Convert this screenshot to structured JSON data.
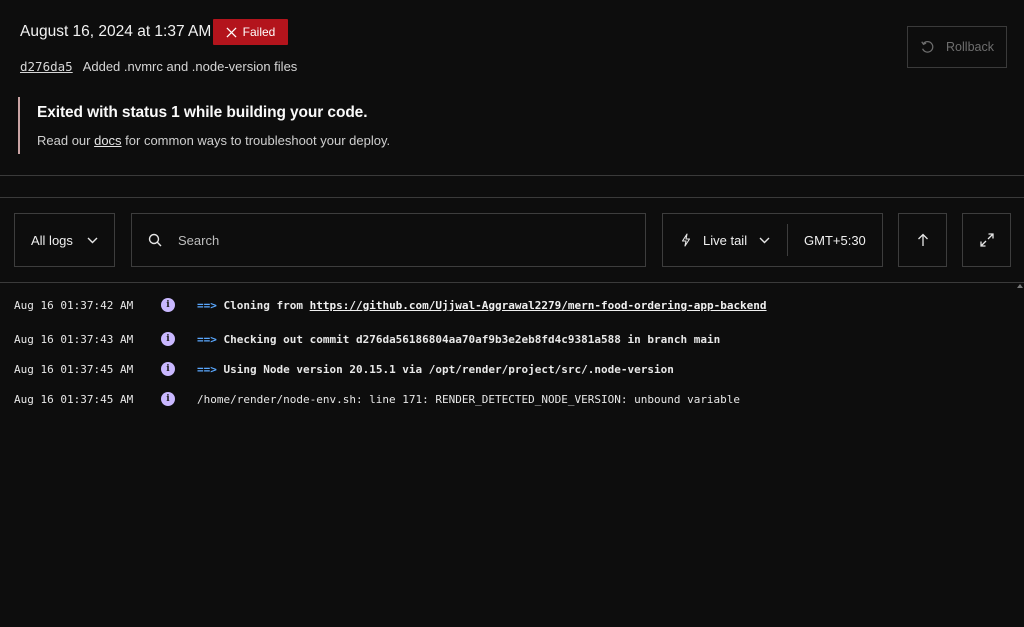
{
  "deploy": {
    "date": "August 16, 2024 at 1:37 AM",
    "status": "Failed",
    "commit_hash": "d276da5",
    "commit_message": "Added .nvmrc and .node-version files",
    "rollback_label": "Rollback"
  },
  "error": {
    "title": "Exited with status 1 while building your code.",
    "prefix": "Read our ",
    "link": "docs",
    "suffix": " for common ways to troubleshoot your deploy."
  },
  "toolbar": {
    "logs_filter": "All logs",
    "search_placeholder": "Search",
    "live_tail": "Live tail",
    "timezone": "GMT+5:30"
  },
  "logs": [
    {
      "ts": "Aug 16 01:37:42 AM",
      "arrow": "==>",
      "text": "Cloning from ",
      "link": "https://github.com/Ujjwal-Aggrawal2279/mern-food-ordering-app-backend"
    },
    {
      "ts": "Aug 16 01:37:43 AM",
      "arrow": "==>",
      "text": "Checking out commit d276da56186804aa70af9b3e2eb8fd4c9381a588 in branch main"
    },
    {
      "ts": "Aug 16 01:37:45 AM",
      "arrow": "==>",
      "text": "Using Node version 20.15.1 via /opt/render/project/src/.node-version"
    },
    {
      "ts": "Aug 16 01:37:45 AM",
      "text": "/home/render/node-env.sh: line 171: RENDER_DETECTED_NODE_VERSION: unbound variable"
    }
  ],
  "colors": {
    "failed_badge": "#b3141c",
    "arrow": "#5aa8ff",
    "info_icon": "#c9b8ff"
  }
}
